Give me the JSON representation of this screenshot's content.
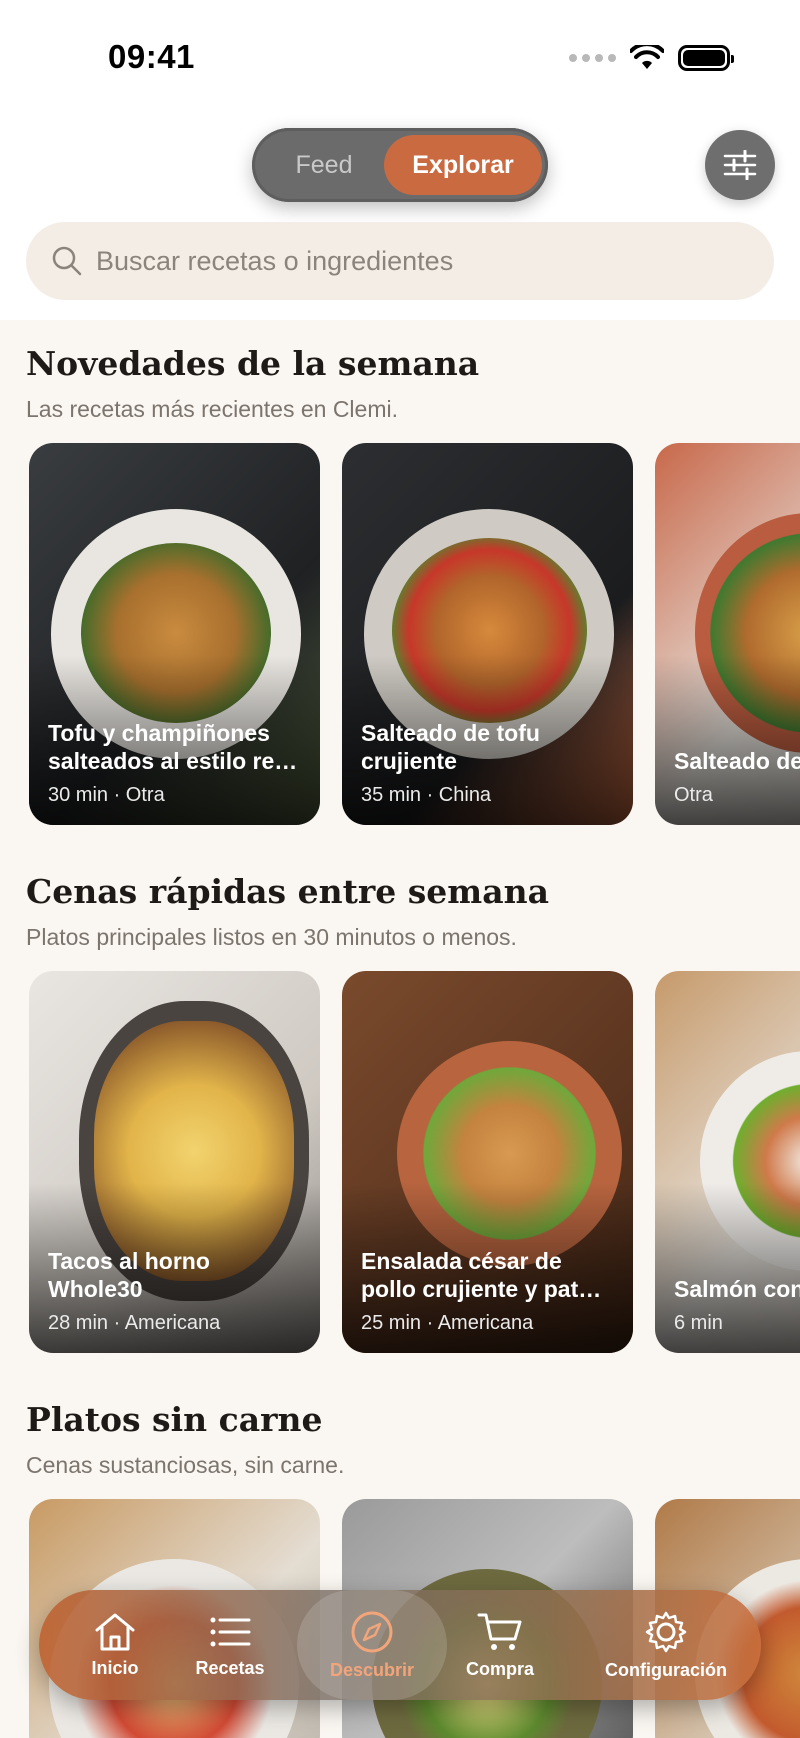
{
  "status_bar": {
    "time": "09:41"
  },
  "header": {
    "segments": [
      {
        "label": "Feed"
      },
      {
        "label": "Explorar"
      }
    ],
    "active_segment": "Explorar",
    "filter_icon": "sliders-icon"
  },
  "search": {
    "placeholder": "Buscar recetas o ingredientes",
    "value": ""
  },
  "sections": [
    {
      "title": "Novedades de la semana",
      "subtitle": "Las recetas más recientes en Clemi.",
      "cards": [
        {
          "title": "Tofu y champiñones salteados al estilo re…",
          "meta": "30 min · Otra"
        },
        {
          "title": "Salteado de tofu crujiente",
          "meta": "35 min · China"
        },
        {
          "title": "Salteado de brócoli",
          "meta": "Otra"
        }
      ]
    },
    {
      "title": "Cenas rápidas entre semana",
      "subtitle": "Platos principales listos en 30 minutos o menos.",
      "cards": [
        {
          "title": "Tacos al horno Whole30",
          "meta": "28 min · Americana"
        },
        {
          "title": "Ensalada césar de pollo crujiente y pat…",
          "meta": "25 min · Americana"
        },
        {
          "title": "Salmón con",
          "meta": "6 min"
        }
      ]
    },
    {
      "title": "Platos sin carne",
      "subtitle": "Cenas sustanciosas, sin carne.",
      "cards": [
        {
          "title": "",
          "meta": ""
        },
        {
          "title": "",
          "meta": ""
        },
        {
          "title": "",
          "meta": ""
        }
      ]
    }
  ],
  "tabbar": {
    "items": [
      {
        "label": "Inicio",
        "icon": "home-icon"
      },
      {
        "label": "Recetas",
        "icon": "list-icon"
      },
      {
        "label": "Descubrir",
        "icon": "compass-icon"
      },
      {
        "label": "Compra",
        "icon": "cart-icon"
      },
      {
        "label": "Configuración",
        "icon": "gear-icon"
      }
    ],
    "active": "Descubrir"
  },
  "colors": {
    "accent": "#c96a41",
    "background": "#faf6f1",
    "search_bg": "#f4ede6"
  }
}
